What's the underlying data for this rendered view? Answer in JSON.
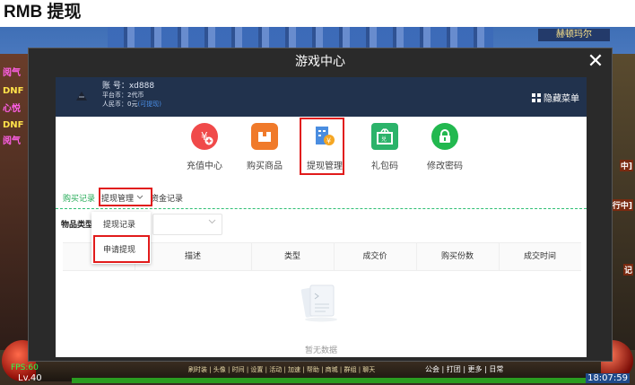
{
  "heading": "RMB 提现",
  "game": {
    "top_name": "赫顿玛尔",
    "side_labels": [
      "阅气",
      "DNF",
      "心悦",
      "DNF",
      "阅气"
    ],
    "right_labels": [
      "中]",
      "行中]",
      "记"
    ],
    "hud_menu": "刷时装 | 头像 | 时间 | 设置 | 活动 | 加速 | 帮助 | 商城 | 群组 | 聊天",
    "hud_menu_right": "公会 | 打团 | 更多 | 日常",
    "fps": "FPS:60",
    "level": "Lv.40",
    "clock": "18:07:59"
  },
  "dialog": {
    "title": "游戏中心",
    "close_glyph": "✕",
    "account": {
      "line1": "账 号：xd888",
      "line2": "平台币：2代币",
      "line3_label": "人民币：0元",
      "line3_link": "(可提现)",
      "hide_menu": "隐藏菜单"
    },
    "icons": [
      {
        "label": "充值中心",
        "icon": "yuan-plus-icon",
        "color": "#f04a4a"
      },
      {
        "label": "购买商品",
        "icon": "box-icon",
        "color": "#f07a2a"
      },
      {
        "label": "提现管理",
        "icon": "withdraw-icon",
        "color": "#4a8de0"
      },
      {
        "label": "礼包码",
        "icon": "gift-cdk-icon",
        "color": "#2bb36a"
      },
      {
        "label": "修改密码",
        "icon": "lock-icon",
        "color": "#22b84f"
      }
    ],
    "tabs": {
      "buy": "购买记录",
      "withdraw": "提现管理",
      "funds": "资金记录"
    },
    "filter_label": "物品类型",
    "dropdown_items": [
      "提现记录",
      "申请提现"
    ],
    "table_headers": [
      "",
      "描述",
      "类型",
      "成交价",
      "购买份数",
      "成交时间"
    ],
    "empty_text": "暂无数据"
  }
}
